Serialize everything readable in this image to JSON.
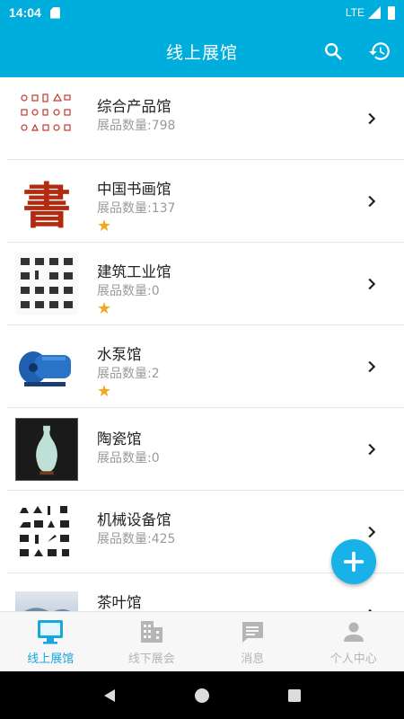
{
  "status_bar": {
    "time": "14:04",
    "network": "LTE"
  },
  "app_bar": {
    "title": "线上展馆"
  },
  "halls": [
    {
      "name": "综合产品馆",
      "count": "展品数量:798",
      "starred": false
    },
    {
      "name": "中国书画馆",
      "count": "展品数量:137",
      "starred": true,
      "thumb_char": "書"
    },
    {
      "name": "建筑工业馆",
      "count": "展品数量:0",
      "starred": true
    },
    {
      "name": "水泵馆",
      "count": "展品数量:2",
      "starred": true
    },
    {
      "name": "陶瓷馆",
      "count": "展品数量:0",
      "starred": false
    },
    {
      "name": "机械设备馆",
      "count": "展品数量:425",
      "starred": false
    },
    {
      "name": "茶叶馆",
      "count": "",
      "starred": false
    }
  ],
  "star_glyph": "★",
  "tabs": [
    {
      "label": "线上展馆",
      "icon": "monitor-icon",
      "active": true
    },
    {
      "label": "线下展会",
      "icon": "building-icon",
      "active": false
    },
    {
      "label": "消息",
      "icon": "message-icon",
      "active": false
    },
    {
      "label": "个人中心",
      "icon": "person-icon",
      "active": false
    }
  ],
  "colors": {
    "primary": "#00aede",
    "fab": "#19b2e8",
    "tab_active": "#1aa6de",
    "tab_inactive": "#b5b5b5",
    "star": "#f5a623"
  }
}
